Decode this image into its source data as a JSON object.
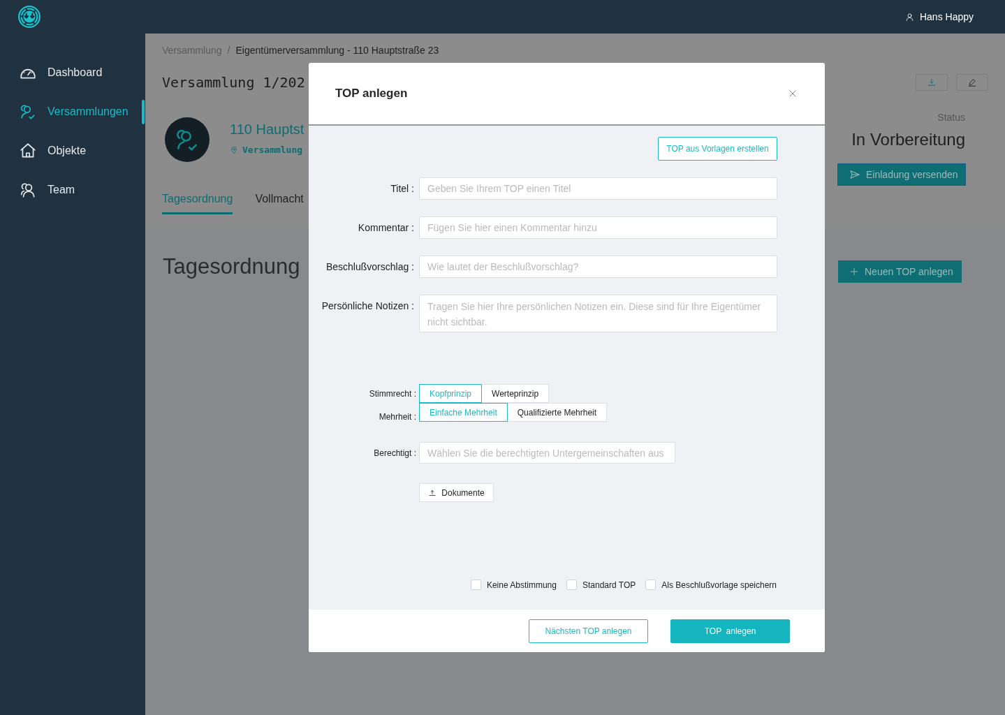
{
  "app": {
    "user": "Hans Happy"
  },
  "sidebar": {
    "items": [
      {
        "label": "Dashboard",
        "selected": false
      },
      {
        "label": "Versammlungen",
        "selected": true
      },
      {
        "label": "Objekte",
        "selected": false
      },
      {
        "label": "Team",
        "selected": false
      }
    ]
  },
  "breadcrumb": {
    "separator": "/",
    "items": [
      "Versammlung",
      "Eigentümerversammlung - 110 Hauptstraße 23"
    ]
  },
  "meeting": {
    "title": "Versammlung 1/202",
    "name": "110 Hauptst",
    "subtitle": "Versammlung",
    "status_label": "Status",
    "status": "In Vorbereitung",
    "send_button": "Einladung versenden"
  },
  "tabs": [
    {
      "label": "Tagesordnung",
      "selected": true
    },
    {
      "label": "Vollmacht",
      "selected": false
    }
  ],
  "section": {
    "title": "Tagesordnung",
    "add_button": "Neuen TOP anlegen"
  },
  "dialog": {
    "title": "TOP anlegen",
    "template_button": "TOP aus Vorlagen erstellen",
    "fields": [
      {
        "label": "Titel :",
        "placeholder": "Geben Sie Ihrem TOP einen Titel",
        "kind": "input"
      },
      {
        "label": "Kommentar :",
        "placeholder": "Fügen Sie hier einen Kommentar hinzu",
        "kind": "input"
      },
      {
        "label": "Beschlußvorschlag :",
        "placeholder": "Wie lautet der Beschlußvorschlag?",
        "kind": "input"
      },
      {
        "label": "Persönliche Notizen :",
        "placeholder": "Tragen Sie hier Ihre persönlichen Notizen ein. Diese sind für Ihre Eigentümer nicht sichtbar.",
        "kind": "textarea"
      }
    ],
    "voting": [
      {
        "label": "Stimmrecht :",
        "options": [
          {
            "label": "Kopfprinzip",
            "selected": true
          },
          {
            "label": "Werteprinzip",
            "selected": false
          }
        ]
      },
      {
        "label": "Mehrheit :",
        "options": [
          {
            "label": "Einfache Mehrheit",
            "selected": true
          },
          {
            "label": "Qualifizierte Mehrheit",
            "selected": false
          }
        ]
      }
    ],
    "eligible": {
      "label": "Berechtigt :",
      "placeholder": "Wählen Sie die berechtigten Untergemeinschaften aus"
    },
    "documents_button": "Dokumente",
    "checkboxes": [
      {
        "label": "Keine Abstimmung",
        "checked": false
      },
      {
        "label": "Standard TOP",
        "checked": false
      },
      {
        "label": "Als Beschlußvorlage speichern",
        "checked": false
      }
    ],
    "buttons": [
      {
        "label": "Nächsten TOP anlegen",
        "kind": "secondary"
      },
      {
        "label": "TOP  anlegen",
        "kind": "primary"
      }
    ]
  }
}
